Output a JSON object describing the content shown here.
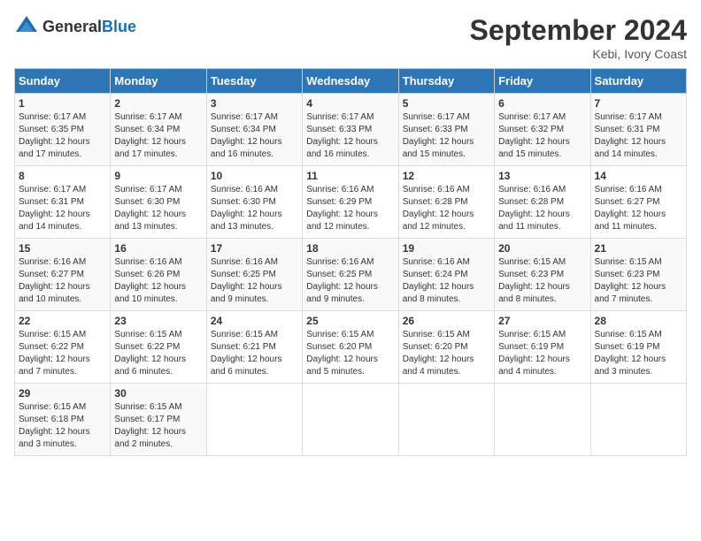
{
  "logo": {
    "general": "General",
    "blue": "Blue"
  },
  "header": {
    "month_year": "September 2024",
    "location": "Kebi, Ivory Coast"
  },
  "weekdays": [
    "Sunday",
    "Monday",
    "Tuesday",
    "Wednesday",
    "Thursday",
    "Friday",
    "Saturday"
  ],
  "weeks": [
    [
      {
        "day": "1",
        "sunrise": "6:17 AM",
        "sunset": "6:35 PM",
        "daylight": "12 hours and 17 minutes."
      },
      {
        "day": "2",
        "sunrise": "6:17 AM",
        "sunset": "6:34 PM",
        "daylight": "12 hours and 17 minutes."
      },
      {
        "day": "3",
        "sunrise": "6:17 AM",
        "sunset": "6:34 PM",
        "daylight": "12 hours and 16 minutes."
      },
      {
        "day": "4",
        "sunrise": "6:17 AM",
        "sunset": "6:33 PM",
        "daylight": "12 hours and 16 minutes."
      },
      {
        "day": "5",
        "sunrise": "6:17 AM",
        "sunset": "6:33 PM",
        "daylight": "12 hours and 15 minutes."
      },
      {
        "day": "6",
        "sunrise": "6:17 AM",
        "sunset": "6:32 PM",
        "daylight": "12 hours and 15 minutes."
      },
      {
        "day": "7",
        "sunrise": "6:17 AM",
        "sunset": "6:31 PM",
        "daylight": "12 hours and 14 minutes."
      }
    ],
    [
      {
        "day": "8",
        "sunrise": "6:17 AM",
        "sunset": "6:31 PM",
        "daylight": "12 hours and 14 minutes."
      },
      {
        "day": "9",
        "sunrise": "6:17 AM",
        "sunset": "6:30 PM",
        "daylight": "12 hours and 13 minutes."
      },
      {
        "day": "10",
        "sunrise": "6:16 AM",
        "sunset": "6:30 PM",
        "daylight": "12 hours and 13 minutes."
      },
      {
        "day": "11",
        "sunrise": "6:16 AM",
        "sunset": "6:29 PM",
        "daylight": "12 hours and 12 minutes."
      },
      {
        "day": "12",
        "sunrise": "6:16 AM",
        "sunset": "6:28 PM",
        "daylight": "12 hours and 12 minutes."
      },
      {
        "day": "13",
        "sunrise": "6:16 AM",
        "sunset": "6:28 PM",
        "daylight": "12 hours and 11 minutes."
      },
      {
        "day": "14",
        "sunrise": "6:16 AM",
        "sunset": "6:27 PM",
        "daylight": "12 hours and 11 minutes."
      }
    ],
    [
      {
        "day": "15",
        "sunrise": "6:16 AM",
        "sunset": "6:27 PM",
        "daylight": "12 hours and 10 minutes."
      },
      {
        "day": "16",
        "sunrise": "6:16 AM",
        "sunset": "6:26 PM",
        "daylight": "12 hours and 10 minutes."
      },
      {
        "day": "17",
        "sunrise": "6:16 AM",
        "sunset": "6:25 PM",
        "daylight": "12 hours and 9 minutes."
      },
      {
        "day": "18",
        "sunrise": "6:16 AM",
        "sunset": "6:25 PM",
        "daylight": "12 hours and 9 minutes."
      },
      {
        "day": "19",
        "sunrise": "6:16 AM",
        "sunset": "6:24 PM",
        "daylight": "12 hours and 8 minutes."
      },
      {
        "day": "20",
        "sunrise": "6:15 AM",
        "sunset": "6:23 PM",
        "daylight": "12 hours and 8 minutes."
      },
      {
        "day": "21",
        "sunrise": "6:15 AM",
        "sunset": "6:23 PM",
        "daylight": "12 hours and 7 minutes."
      }
    ],
    [
      {
        "day": "22",
        "sunrise": "6:15 AM",
        "sunset": "6:22 PM",
        "daylight": "12 hours and 7 minutes."
      },
      {
        "day": "23",
        "sunrise": "6:15 AM",
        "sunset": "6:22 PM",
        "daylight": "12 hours and 6 minutes."
      },
      {
        "day": "24",
        "sunrise": "6:15 AM",
        "sunset": "6:21 PM",
        "daylight": "12 hours and 6 minutes."
      },
      {
        "day": "25",
        "sunrise": "6:15 AM",
        "sunset": "6:20 PM",
        "daylight": "12 hours and 5 minutes."
      },
      {
        "day": "26",
        "sunrise": "6:15 AM",
        "sunset": "6:20 PM",
        "daylight": "12 hours and 4 minutes."
      },
      {
        "day": "27",
        "sunrise": "6:15 AM",
        "sunset": "6:19 PM",
        "daylight": "12 hours and 4 minutes."
      },
      {
        "day": "28",
        "sunrise": "6:15 AM",
        "sunset": "6:19 PM",
        "daylight": "12 hours and 3 minutes."
      }
    ],
    [
      {
        "day": "29",
        "sunrise": "6:15 AM",
        "sunset": "6:18 PM",
        "daylight": "12 hours and 3 minutes."
      },
      {
        "day": "30",
        "sunrise": "6:15 AM",
        "sunset": "6:17 PM",
        "daylight": "12 hours and 2 minutes."
      },
      null,
      null,
      null,
      null,
      null
    ]
  ]
}
